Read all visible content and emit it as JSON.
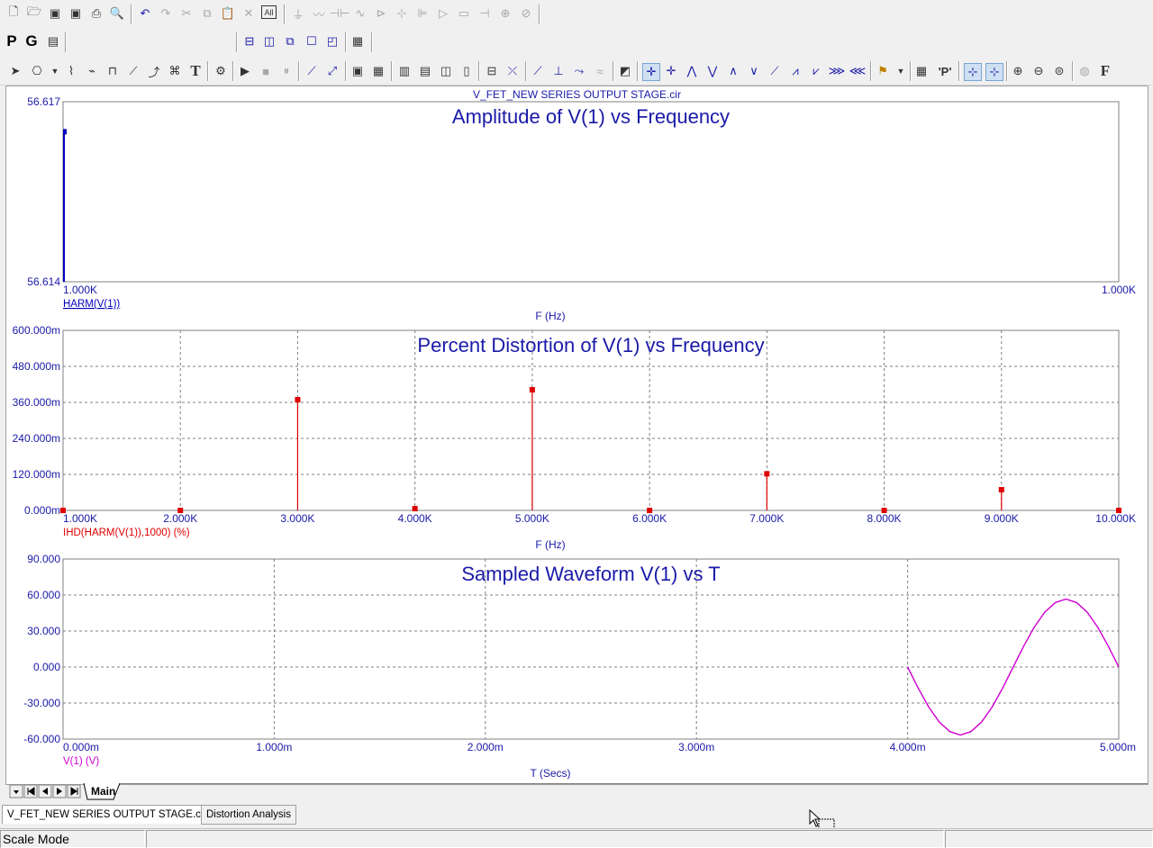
{
  "file_title": "V_FET_NEW SERIES OUTPUT STAGE.cir",
  "toolbar2": {
    "p_label": "P",
    "g_label": "G"
  },
  "plots": [
    {
      "title": "Amplitude of V(1) vs Frequency",
      "y_ticks": [
        "56.617",
        "56.614"
      ],
      "x_ticks": [
        "1.000K",
        "1.000K"
      ],
      "x_axis_label": "F (Hz)",
      "trace_label": "HARM(V(1))"
    },
    {
      "title": "Percent Distortion of V(1) vs Frequency",
      "y_ticks": [
        "600.000m",
        "480.000m",
        "360.000m",
        "240.000m",
        "120.000m",
        "0.000m"
      ],
      "x_ticks": [
        "1.000K",
        "2.000K",
        "3.000K",
        "4.000K",
        "5.000K",
        "6.000K",
        "7.000K",
        "8.000K",
        "9.000K",
        "10.000K"
      ],
      "x_axis_label": "F (Hz)",
      "trace_label": "IHD(HARM(V(1)),1000) (%)"
    },
    {
      "title": "Sampled Waveform  V(1) vs T",
      "y_ticks": [
        "90.000",
        "60.000",
        "30.000",
        "0.000",
        "-30.000",
        "-60.000"
      ],
      "x_ticks": [
        "0.000m",
        "1.000m",
        "2.000m",
        "3.000m",
        "4.000m",
        "5.000m"
      ],
      "x_axis_label": "T (Secs)",
      "trace_label": "V(1) (V)"
    }
  ],
  "colors": {
    "title": "#1a1aa8",
    "axis_text": "#1a1aa8",
    "harm_trace": "#0000c0",
    "ihd_trace": "#e00000",
    "wave_trace": "#d000d0",
    "grid": "#808080"
  },
  "chart_data": [
    {
      "type": "bar",
      "title": "Amplitude of V(1) vs Frequency",
      "xlabel": "F (Hz)",
      "ylabel": "",
      "series": [
        {
          "name": "HARM(V(1))",
          "x": [
            1000
          ],
          "values": [
            56.6165
          ]
        }
      ],
      "xlim": [
        1000,
        1000
      ],
      "ylim": [
        56.614,
        56.617
      ],
      "grid": false
    },
    {
      "type": "bar",
      "title": "Percent Distortion of V(1) vs Frequency",
      "xlabel": "F (Hz)",
      "ylabel": "",
      "series": [
        {
          "name": "IHD(HARM(V(1)),1000) (%)",
          "x": [
            1000,
            2000,
            3000,
            4000,
            5000,
            6000,
            7000,
            8000,
            9000,
            10000
          ],
          "values": [
            0,
            0,
            0.369,
            0.006,
            0.402,
            0,
            0.122,
            0,
            0.069,
            0
          ]
        }
      ],
      "xlim": [
        1000,
        10000
      ],
      "ylim": [
        0,
        0.6
      ],
      "grid": true
    },
    {
      "type": "line",
      "title": "Sampled Waveform  V(1) vs T",
      "xlabel": "T (Secs)",
      "ylabel": "",
      "series": [
        {
          "name": "V(1) (V)",
          "x": [
            0.004,
            0.00405,
            0.0041,
            0.00415,
            0.0042,
            0.00425,
            0.0043,
            0.00435,
            0.0044,
            0.00445,
            0.0045,
            0.00455,
            0.0046,
            0.00465,
            0.0047,
            0.00475,
            0.0048,
            0.00485,
            0.0049,
            0.00495,
            0.005
          ],
          "values": [
            0,
            -17.5,
            -33.3,
            -45.8,
            -53.8,
            -56.6,
            -53.8,
            -45.8,
            -33.3,
            -17.5,
            0,
            17.5,
            33.3,
            45.8,
            53.8,
            56.6,
            53.8,
            45.8,
            33.3,
            17.5,
            0
          ]
        }
      ],
      "xlim": [
        0,
        0.005
      ],
      "ylim": [
        -60,
        90
      ],
      "grid": true
    }
  ],
  "sheet_tabs": {
    "main_label": "Main"
  },
  "file_tabs": {
    "circuit_label": "V_FET_NEW SERIES OUTPUT STAGE.cir",
    "analysis_label": "Distortion Analysis"
  },
  "status": {
    "mode_text": "Scale Mode"
  }
}
